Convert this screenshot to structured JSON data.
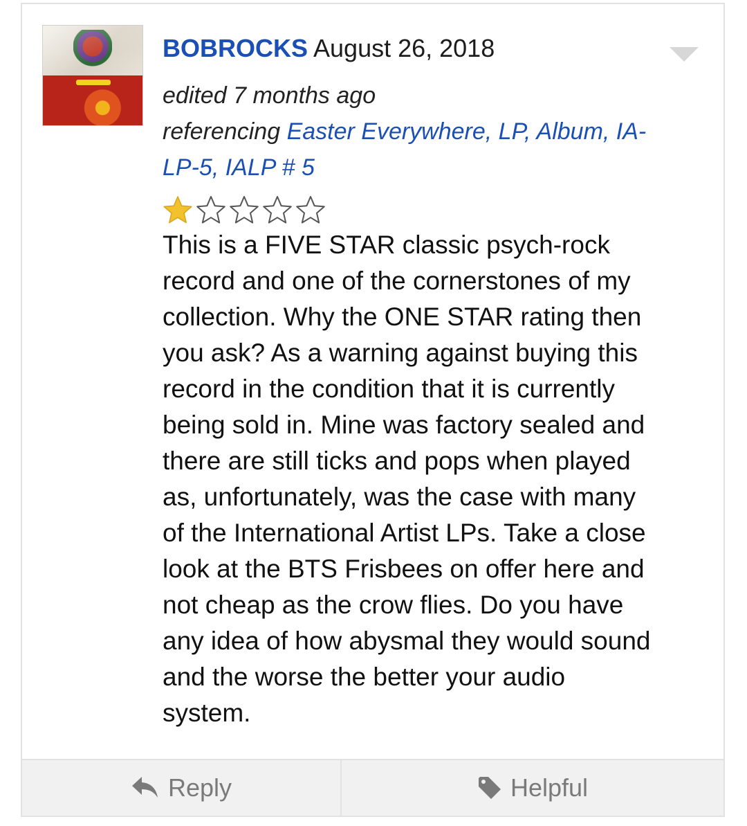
{
  "review": {
    "username": "BOBROCKS",
    "date": "August 26, 2018",
    "edited": "edited 7 months ago",
    "referencing_prefix": "referencing",
    "referencing_line1": "Easter Everywhere, LP, Album, IA-",
    "referencing_line2": "LP-5, IALP # 5",
    "rating": 1,
    "rating_max": 5,
    "body_lines": [
      "This is a FIVE STAR classic psych-rock",
      "record and one of the cornerstones of my",
      "collection. Why the ONE STAR rating then",
      "you ask? As a warning against buying this",
      "record in the condition that it is currently",
      "being sold in. Mine was factory sealed and",
      "there are still ticks and pops when played",
      "as, unfortunately, was the case with many",
      "of the International Artist LPs. Take a close",
      "look at the BTS Frisbees on offer here and",
      "not cheap as the crow flies. Do you have",
      "any idea of how abysmal they would sound",
      "and the worse the better your audio",
      "system."
    ]
  },
  "footer": {
    "reply_label": "Reply",
    "helpful_label": "Helpful"
  },
  "colors": {
    "link": "#1a4fb5",
    "star_filled": "#f2c12e",
    "star_empty_stroke": "#555555",
    "footer_bg": "#f1f1f1",
    "footer_text": "#7a7a7a"
  },
  "icons": {
    "reply": "reply-arrow-icon",
    "helpful": "tag-icon",
    "menu": "chevron-down-icon"
  }
}
